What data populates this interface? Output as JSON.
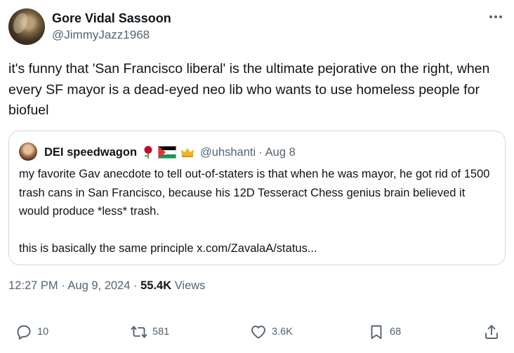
{
  "author": {
    "display_name": "Gore Vidal Sassoon",
    "handle": "@JimmyJazz1968"
  },
  "tweet": {
    "text": "it's funny that 'San Francisco liberal' is the ultimate pejorative on the right, when every SF mayor is a dead-eyed neo lib who wants to use homeless people for biofuel"
  },
  "quoted": {
    "display_name": "DEI speedwagon",
    "emojis": [
      "rose-icon",
      "palestine-flag-icon",
      "crown-icon"
    ],
    "handle": "@uhshanti",
    "separator": "·",
    "date": "Aug 8",
    "paragraph1": "my favorite Gav anecdote to tell out-of-staters is that when he was mayor, he got rid of 1500 trash cans in San Francisco, because his 12D Tesseract Chess genius brain believed it would produce *less* trash.",
    "paragraph2": "this is basically the same principle x.com/ZavalaA/status..."
  },
  "meta": {
    "time": "12:27 PM",
    "separator": "·",
    "date": "Aug 9, 2024",
    "views_count": "55.4K",
    "views_label": "Views"
  },
  "actions": {
    "replies": "10",
    "reposts": "581",
    "likes": "3.6K",
    "bookmarks": "68"
  },
  "colors": {
    "text": "#0f1419",
    "secondary": "#536471",
    "border": "#cfd9de"
  }
}
